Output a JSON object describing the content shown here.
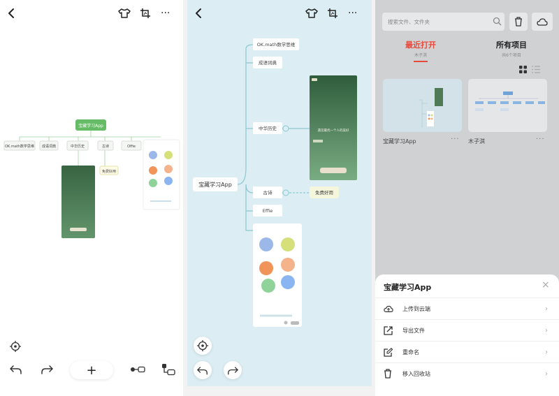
{
  "colors": {
    "accent_red": "#e64a3b",
    "map_bg": "#dceef4",
    "root_green": "#66bb66",
    "branch_line": "#8cc7cf"
  },
  "panel1": {
    "icons": [
      "back-icon",
      "theme-shirt-icon",
      "crop-frame-icon",
      "more-icon"
    ],
    "root": "宝藏学习App",
    "branches": [
      "OK.math数学思维",
      "成语词典",
      "中华历史",
      "古诗",
      "Offie"
    ],
    "sub": "免费好用",
    "toolbar": {
      "add": "+"
    }
  },
  "panel2": {
    "root": "宝藏学习App",
    "nodes": [
      "OK.math数学思维",
      "成语词典",
      "中华历史",
      "古诗",
      "Effie"
    ],
    "sub": "免费好用",
    "poster_text": "遇见最优一个人的美好"
  },
  "panel3": {
    "search_placeholder": "搜索文件、文件夹",
    "tabs": [
      {
        "title": "最近打开",
        "sub": "木子淇"
      },
      {
        "title": "所有项目",
        "sub": "共6个项目"
      }
    ],
    "files": [
      {
        "name": "宝藏学习App",
        "more": "···"
      },
      {
        "name": "木子淇",
        "more": "···"
      }
    ],
    "sheet": {
      "title": "宝藏学习App",
      "close": "×",
      "actions": [
        "上传到云端",
        "导出文件",
        "重命名",
        "移入回收站"
      ]
    }
  }
}
